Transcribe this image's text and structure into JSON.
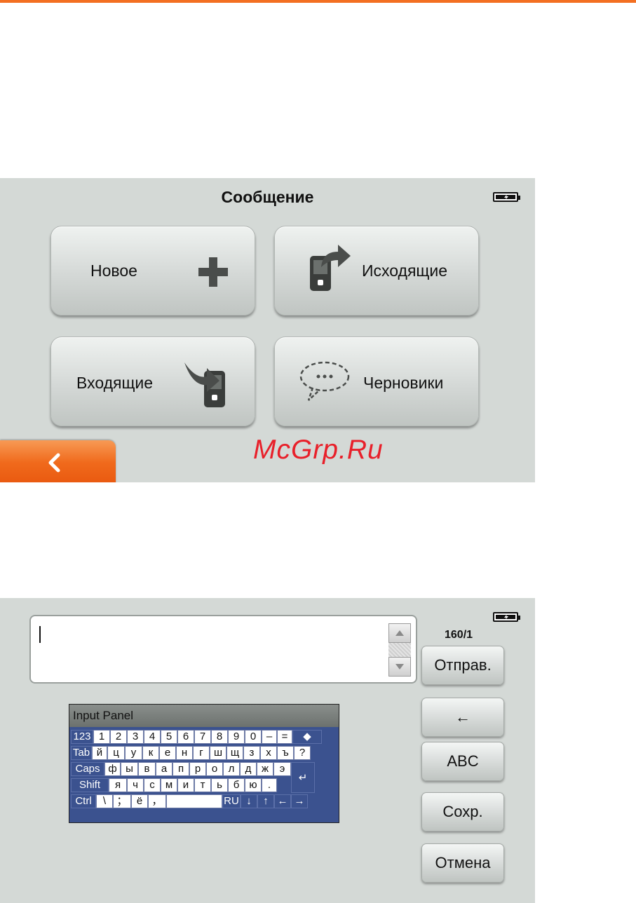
{
  "screen1": {
    "title": "Сообщение",
    "tiles": [
      {
        "label": "Новое",
        "icon": "plus-icon"
      },
      {
        "label": "Исходящие",
        "icon": "phone-arrow-out-icon"
      },
      {
        "label": "Входящие",
        "icon": "phone-arrow-in-icon"
      },
      {
        "label": "Черновики",
        "icon": "speech-bubble-icon"
      }
    ],
    "back_icon": "chevron-left-icon",
    "battery_icon": "battery-charging-icon"
  },
  "watermark": "McGrp.Ru",
  "screen2": {
    "counter": "160/1",
    "side_buttons": [
      "Отправ.",
      "←",
      "ABC",
      "Сохр.",
      "Отмена"
    ],
    "keyboard": {
      "title": "Input Panel",
      "rows": [
        [
          "123",
          "1",
          "2",
          "3",
          "4",
          "5",
          "6",
          "7",
          "8",
          "9",
          "0",
          "–",
          "=",
          "◆"
        ],
        [
          "Tab",
          "й",
          "ц",
          "у",
          "к",
          "е",
          "н",
          "г",
          "ш",
          "щ",
          "з",
          "х",
          "ъ",
          "?"
        ],
        [
          "Caps",
          "ф",
          "ы",
          "в",
          "а",
          "п",
          "р",
          "о",
          "л",
          "д",
          "ж",
          "э",
          "↵"
        ],
        [
          "Shift",
          "я",
          "ч",
          "с",
          "м",
          "и",
          "т",
          "ь",
          "б",
          "ю",
          "."
        ],
        [
          "Ctrl",
          "\\",
          "；",
          "ё",
          "，",
          "",
          "RU",
          "↓",
          "↑",
          "←",
          "→"
        ]
      ]
    }
  },
  "colors": {
    "accent": "#f36f21",
    "screen_bg": "#d4d9d6",
    "keyboard_blue": "#3b528f",
    "watermark": "#e8202a"
  }
}
